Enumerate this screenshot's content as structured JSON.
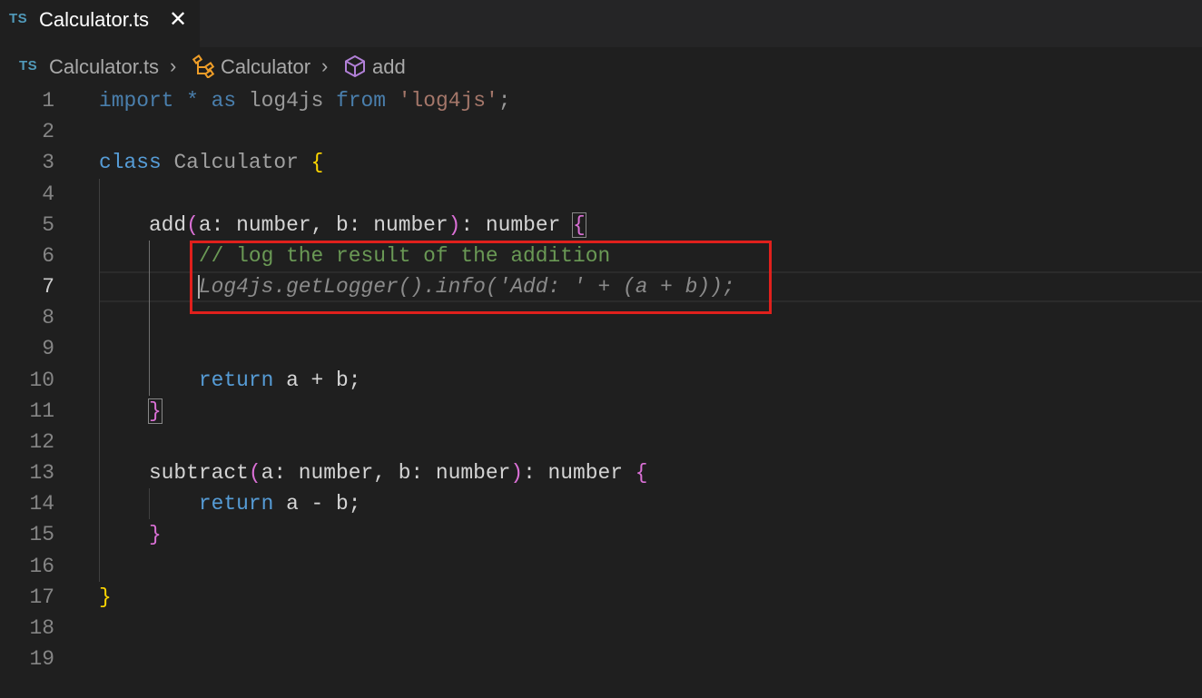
{
  "tab": {
    "language_badge": "TS",
    "label": "Calculator.ts",
    "close_glyph": "✕"
  },
  "breadcrumb": {
    "language_badge": "TS",
    "items": [
      {
        "label": "Calculator.ts",
        "icon": "typescript-file-icon"
      },
      {
        "label": "Calculator",
        "icon": "class-symbol-icon"
      },
      {
        "label": "add",
        "icon": "method-symbol-icon"
      }
    ],
    "separator": "›"
  },
  "editor": {
    "current_line": 7,
    "highlighted_region_lines": [
      6,
      7
    ],
    "highlight_color": "#e0201c",
    "lines": [
      {
        "n": "1",
        "tokens": [
          {
            "t": "import",
            "c": "tk-keyword-faded"
          },
          {
            "t": " ",
            "c": "tk-plain"
          },
          {
            "t": "*",
            "c": "tk-keyword-faded"
          },
          {
            "t": " ",
            "c": "tk-plain"
          },
          {
            "t": "as",
            "c": "tk-keyword-faded"
          },
          {
            "t": " ",
            "c": "tk-plain"
          },
          {
            "t": "log4js",
            "c": "tk-ident-faded"
          },
          {
            "t": " ",
            "c": "tk-plain"
          },
          {
            "t": "from",
            "c": "tk-keyword-faded"
          },
          {
            "t": " ",
            "c": "tk-plain"
          },
          {
            "t": "'log4js'",
            "c": "tk-string-faded"
          },
          {
            "t": ";",
            "c": "tk-ident-faded"
          }
        ]
      },
      {
        "n": "2",
        "tokens": []
      },
      {
        "n": "3",
        "tokens": [
          {
            "t": "class",
            "c": "tk-keyword"
          },
          {
            "t": " ",
            "c": "tk-plain"
          },
          {
            "t": "Calculator",
            "c": "tk-class-faded"
          },
          {
            "t": " ",
            "c": "tk-plain"
          },
          {
            "t": "{",
            "c": "tk-brace-gold"
          }
        ]
      },
      {
        "n": "4",
        "tokens": []
      },
      {
        "n": "5",
        "tokens": [
          {
            "t": "    add",
            "c": "tk-plain"
          },
          {
            "t": "(",
            "c": "tk-brace-pink"
          },
          {
            "t": "a: number, b: number",
            "c": "tk-plain"
          },
          {
            "t": ")",
            "c": "tk-brace-pink"
          },
          {
            "t": ": number ",
            "c": "tk-plain"
          },
          {
            "t": "{",
            "c": "tk-brace-pink brace-match"
          }
        ]
      },
      {
        "n": "6",
        "tokens": [
          {
            "t": "        ",
            "c": "tk-plain"
          },
          {
            "t": "// log the result of the addition",
            "c": "tk-comment"
          }
        ]
      },
      {
        "n": "7",
        "tokens": [
          {
            "t": "        ",
            "c": "tk-plain"
          },
          {
            "t": "Log4js.getLogger().info('Add: ' + (a + b));",
            "c": "tk-ghost"
          }
        ]
      },
      {
        "n": "8",
        "tokens": []
      },
      {
        "n": "9",
        "tokens": []
      },
      {
        "n": "10",
        "tokens": [
          {
            "t": "        ",
            "c": "tk-plain"
          },
          {
            "t": "return",
            "c": "tk-return"
          },
          {
            "t": " a + b;",
            "c": "tk-plain"
          }
        ]
      },
      {
        "n": "11",
        "tokens": [
          {
            "t": "    ",
            "c": "tk-plain"
          },
          {
            "t": "}",
            "c": "tk-brace-pink brace-match"
          }
        ]
      },
      {
        "n": "12",
        "tokens": []
      },
      {
        "n": "13",
        "tokens": [
          {
            "t": "    subtract",
            "c": "tk-plain"
          },
          {
            "t": "(",
            "c": "tk-brace-pink"
          },
          {
            "t": "a: number, b: number",
            "c": "tk-plain"
          },
          {
            "t": ")",
            "c": "tk-brace-pink"
          },
          {
            "t": ": number ",
            "c": "tk-plain"
          },
          {
            "t": "{",
            "c": "tk-brace-pink"
          }
        ]
      },
      {
        "n": "14",
        "tokens": [
          {
            "t": "        ",
            "c": "tk-plain"
          },
          {
            "t": "return",
            "c": "tk-return"
          },
          {
            "t": " a - b;",
            "c": "tk-plain"
          }
        ]
      },
      {
        "n": "15",
        "tokens": [
          {
            "t": "    ",
            "c": "tk-plain"
          },
          {
            "t": "}",
            "c": "tk-brace-pink"
          }
        ]
      },
      {
        "n": "16",
        "tokens": []
      },
      {
        "n": "17",
        "tokens": [
          {
            "t": "}",
            "c": "tk-brace-gold"
          }
        ]
      },
      {
        "n": "18",
        "tokens": []
      },
      {
        "n": "19",
        "tokens": []
      }
    ]
  }
}
